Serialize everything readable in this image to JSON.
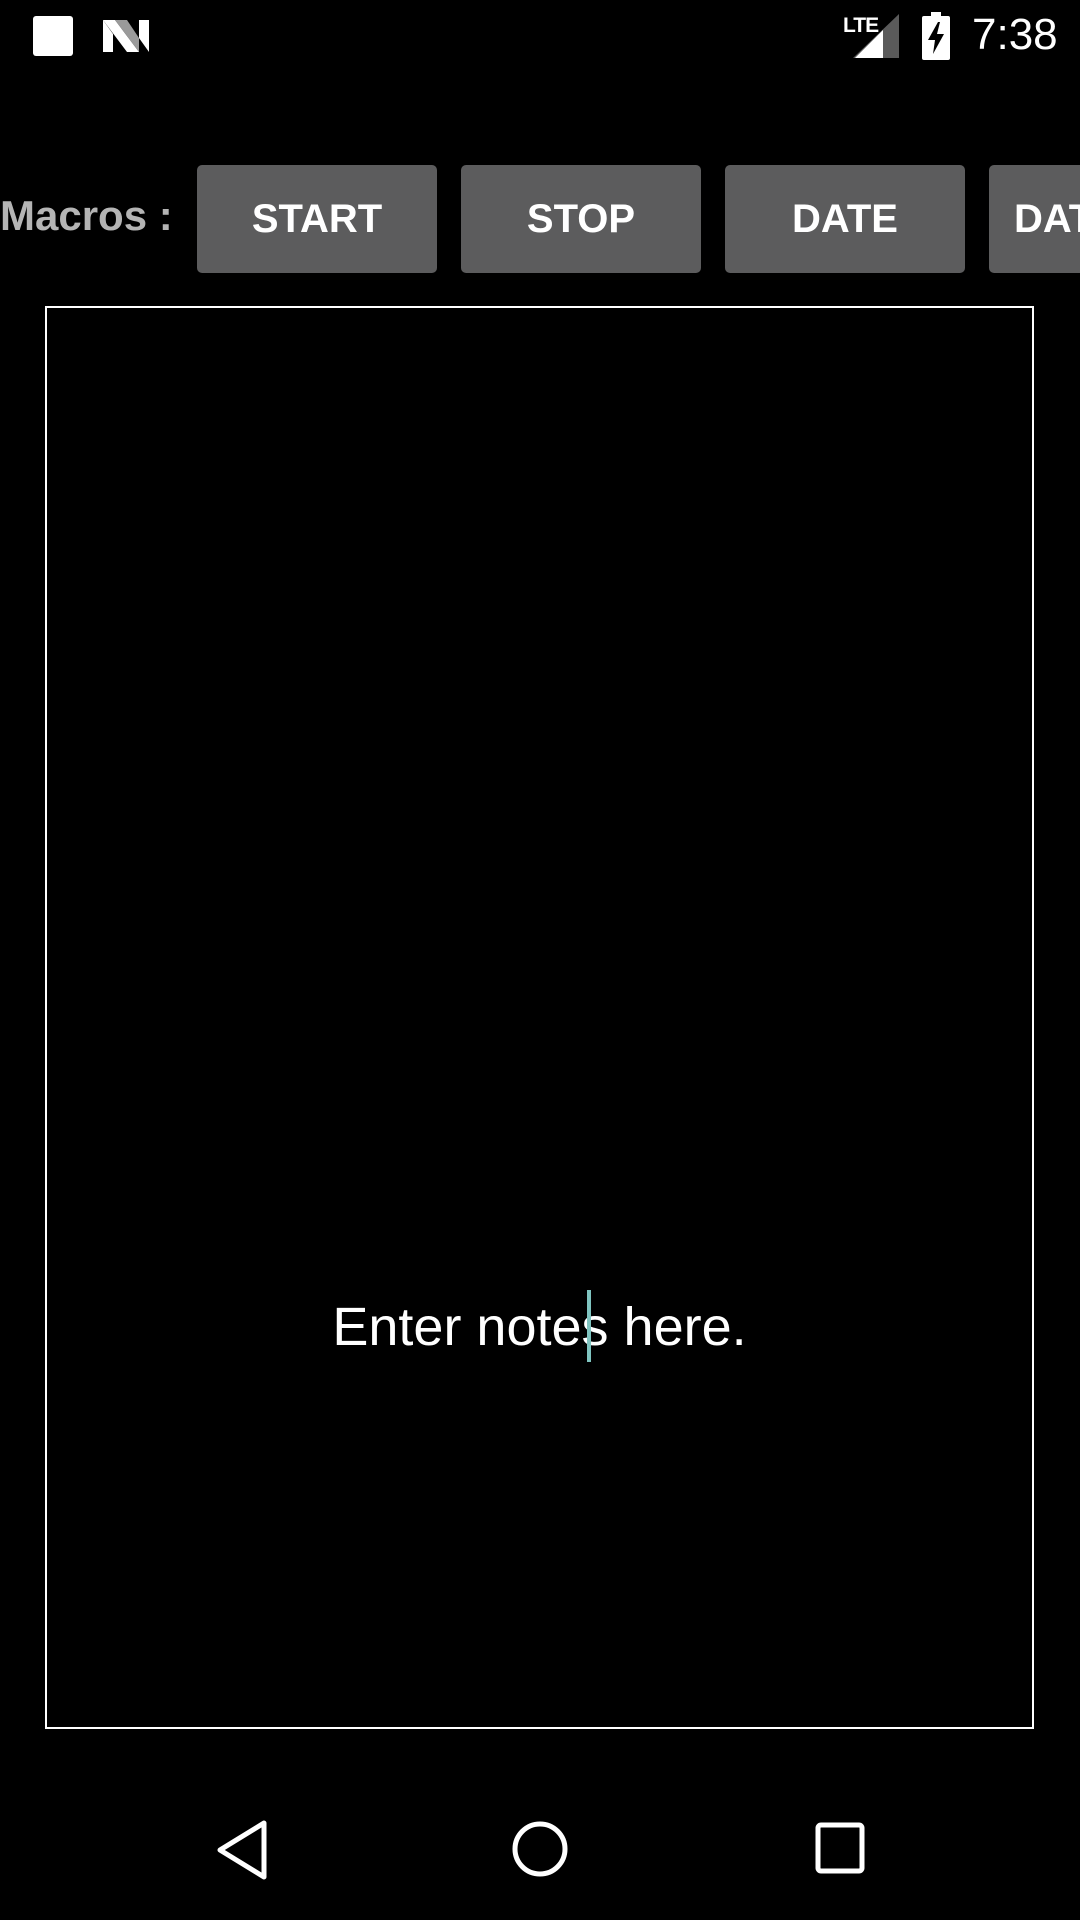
{
  "status_bar": {
    "time": "7:38",
    "network_type": "LTE",
    "icons": [
      "notification-square-icon",
      "n-logo-icon",
      "signal-icon",
      "battery-charging-icon"
    ]
  },
  "macros": {
    "label": "Macros :",
    "buttons": [
      {
        "label": "START"
      },
      {
        "label": "STOP"
      },
      {
        "label": "DATE"
      },
      {
        "label": "DAT"
      }
    ]
  },
  "notes": {
    "placeholder": "Enter notes here."
  },
  "nav_bar": {
    "icons": [
      "back-icon",
      "home-icon",
      "recents-icon"
    ]
  },
  "colors": {
    "background": "#000000",
    "button": "#5c5c5d",
    "label": "#b4b4b4",
    "cursor": "#7fc4c0"
  }
}
